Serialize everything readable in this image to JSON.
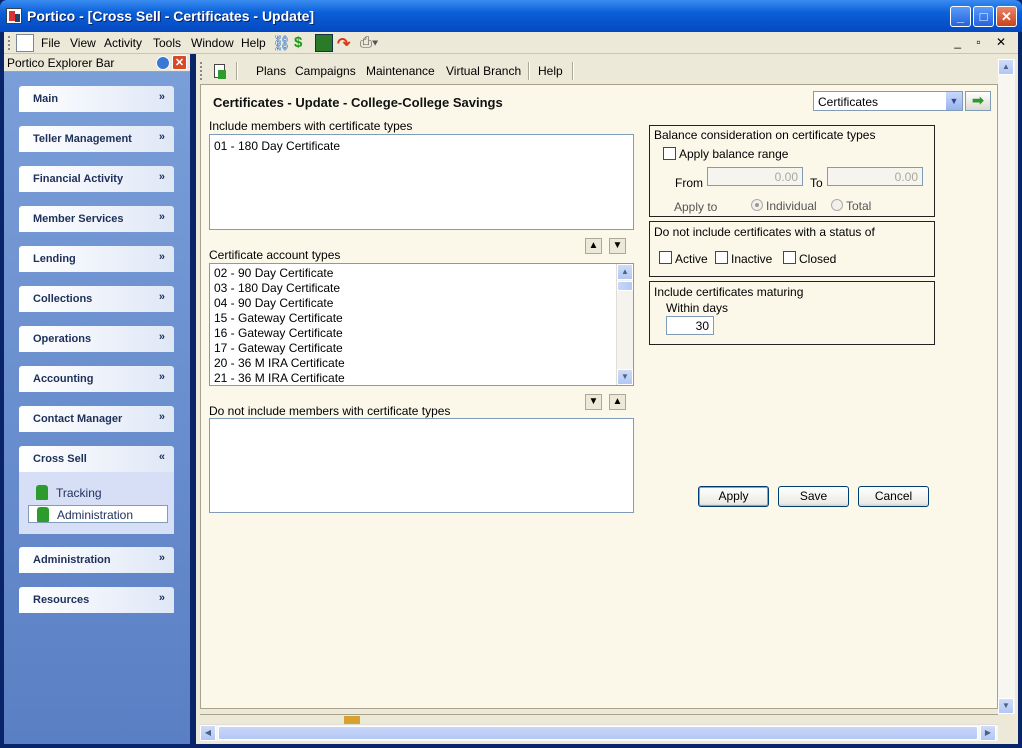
{
  "window": {
    "title": "Portico - [Cross Sell - Certificates - Update]"
  },
  "menubar": {
    "items": [
      "File",
      "View",
      "Activity",
      "Tools",
      "Window",
      "Help"
    ],
    "mdi_controls": "_ ▫ ✕"
  },
  "explorer": {
    "title": "Portico Explorer Bar",
    "groups": [
      {
        "label": "Main"
      },
      {
        "label": "Teller Management"
      },
      {
        "label": "Financial Activity"
      },
      {
        "label": "Member Services"
      },
      {
        "label": "Lending"
      },
      {
        "label": "Collections"
      },
      {
        "label": "Operations"
      },
      {
        "label": "Accounting"
      },
      {
        "label": "Contact Manager"
      },
      {
        "label": "Cross Sell"
      },
      {
        "label": "Administration"
      },
      {
        "label": "Resources"
      }
    ],
    "cross_sell_tasks": [
      "Tracking",
      "Administration"
    ]
  },
  "toolbar2": {
    "items": [
      "Plans",
      "Campaigns",
      "Maintenance",
      "Virtual Branch",
      "Help"
    ]
  },
  "page": {
    "title": "Certificates - Update - College-College Savings",
    "nav_select_value": "Certificates",
    "include_label": "Include members with certificate types",
    "include_list": [
      "01 - 180 Day Certificate"
    ],
    "account_types_label": "Certificate account types",
    "account_types_list": [
      "02 - 90 Day Certificate",
      "03 - 180 Day Certificate",
      "04 - 90 Day Certificate",
      "15 - Gateway Certificate",
      "16 - Gateway Certificate",
      "17 - Gateway Certificate",
      "20 - 36 M IRA Certificate",
      "21 - 36 M IRA Certificate"
    ],
    "exclude_label": "Do not include members with certificate types",
    "exclude_list": []
  },
  "balance": {
    "legend": "Balance consideration on certificate types",
    "apply_range_label": "Apply balance range",
    "from_label": "From",
    "from_value": "0.00",
    "to_label": "To",
    "to_value": "0.00",
    "apply_to_label": "Apply to",
    "individual_label": "Individual",
    "total_label": "Total"
  },
  "status": {
    "legend": "Do not include certificates with a status of",
    "active_label": "Active",
    "inactive_label": "Inactive",
    "closed_label": "Closed"
  },
  "maturing": {
    "legend": "Include certificates maturing",
    "within_label": "Within days",
    "within_value": "30"
  },
  "buttons": {
    "apply": "Apply",
    "save": "Save",
    "cancel": "Cancel"
  }
}
